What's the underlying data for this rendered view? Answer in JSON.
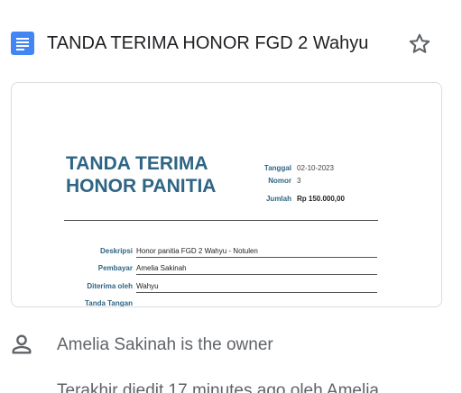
{
  "header": {
    "title": "TANDA TERIMA HONOR FGD 2 Wahyu",
    "doc_icon": "google-docs-icon",
    "star_icon": "star-outline-icon"
  },
  "preview": {
    "title_line1": "TANDA TERIMA",
    "title_line2": "HONOR PANITIA",
    "meta": {
      "tanggal_label": "Tanggal",
      "tanggal_value": "02-10-2023",
      "nomor_label": "Nomor",
      "nomor_value": "3",
      "jumlah_label": "Jumlah",
      "jumlah_value": "Rp 150.000,00"
    },
    "fields": {
      "deskripsi_label": "Deskripsi",
      "deskripsi_value": "Honor panitia FGD 2 Wahyu - Notulen",
      "pembayar_label": "Pembayar",
      "pembayar_value": "Amelia Sakinah",
      "diterima_label": "Diterima oleh",
      "diterima_value": "Wahyu",
      "tanda_tangan_label": "Tanda Tangan"
    }
  },
  "details": {
    "owner_icon": "person-icon",
    "owner_text": "Amelia Sakinah is the owner",
    "edited_text": "Terakhir diedit 17 minutes ago oleh Amelia"
  },
  "colors": {
    "doc_blue": "#4285f4",
    "preview_title": "#2f6584",
    "text_secondary": "#5f6368"
  }
}
